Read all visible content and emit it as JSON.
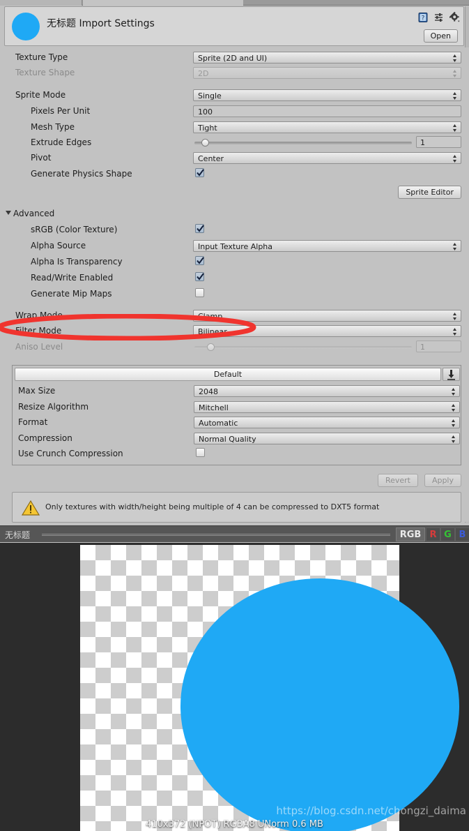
{
  "window": {
    "title": "无标题 Import Settings",
    "open_button": "Open",
    "icons": {
      "help": "help-book-icon",
      "preset": "preset-sliders-icon",
      "settings": "gear-icon"
    },
    "accent_blue": "#1FA9F5"
  },
  "settings": {
    "texture_type": {
      "label": "Texture Type",
      "value": "Sprite (2D and UI)"
    },
    "texture_shape": {
      "label": "Texture Shape",
      "value": "2D",
      "disabled": true
    },
    "sprite_mode": {
      "label": "Sprite Mode",
      "value": "Single"
    },
    "pixels_per_unit": {
      "label": "Pixels Per Unit",
      "value": "100"
    },
    "mesh_type": {
      "label": "Mesh Type",
      "value": "Tight"
    },
    "extrude_edges": {
      "label": "Extrude Edges",
      "value": "1"
    },
    "pivot": {
      "label": "Pivot",
      "value": "Center"
    },
    "generate_physics_shape": {
      "label": "Generate Physics Shape",
      "checked": true
    },
    "sprite_editor_button": "Sprite Editor"
  },
  "advanced": {
    "header": "Advanced",
    "srgb": {
      "label": "sRGB (Color Texture)",
      "checked": true
    },
    "alpha_source": {
      "label": "Alpha Source",
      "value": "Input Texture Alpha"
    },
    "alpha_is_transparency": {
      "label": "Alpha Is Transparency",
      "checked": true
    },
    "read_write_enabled": {
      "label": "Read/Write Enabled",
      "checked": true,
      "highlighted": true
    },
    "generate_mip_maps": {
      "label": "Generate Mip Maps",
      "checked": false
    }
  },
  "sampling": {
    "wrap_mode": {
      "label": "Wrap Mode",
      "value": "Clamp"
    },
    "filter_mode": {
      "label": "Filter Mode",
      "value": "Bilinear"
    },
    "aniso_level": {
      "label": "Aniso Level",
      "value": "1",
      "disabled": true
    }
  },
  "platform": {
    "tab_label": "Default",
    "max_size": {
      "label": "Max Size",
      "value": "2048"
    },
    "resize_algorithm": {
      "label": "Resize Algorithm",
      "value": "Mitchell"
    },
    "format": {
      "label": "Format",
      "value": "Automatic"
    },
    "compression": {
      "label": "Compression",
      "value": "Normal Quality"
    },
    "use_crunch_compression": {
      "label": "Use Crunch Compression",
      "checked": false
    }
  },
  "footer": {
    "revert_button": "Revert",
    "apply_button": "Apply",
    "warning": "Only textures with width/height being multiple of 4 can be compressed to DXT5 format"
  },
  "preview": {
    "title": "无标题",
    "channels": {
      "rgb": "RGB",
      "r": "R",
      "g": "G",
      "b": "B"
    },
    "info": "410x372 (NPOT)  RGBA8 UNorm  0.6 MB",
    "watermark": "https://blog.csdn.net/chongzi_daima"
  }
}
